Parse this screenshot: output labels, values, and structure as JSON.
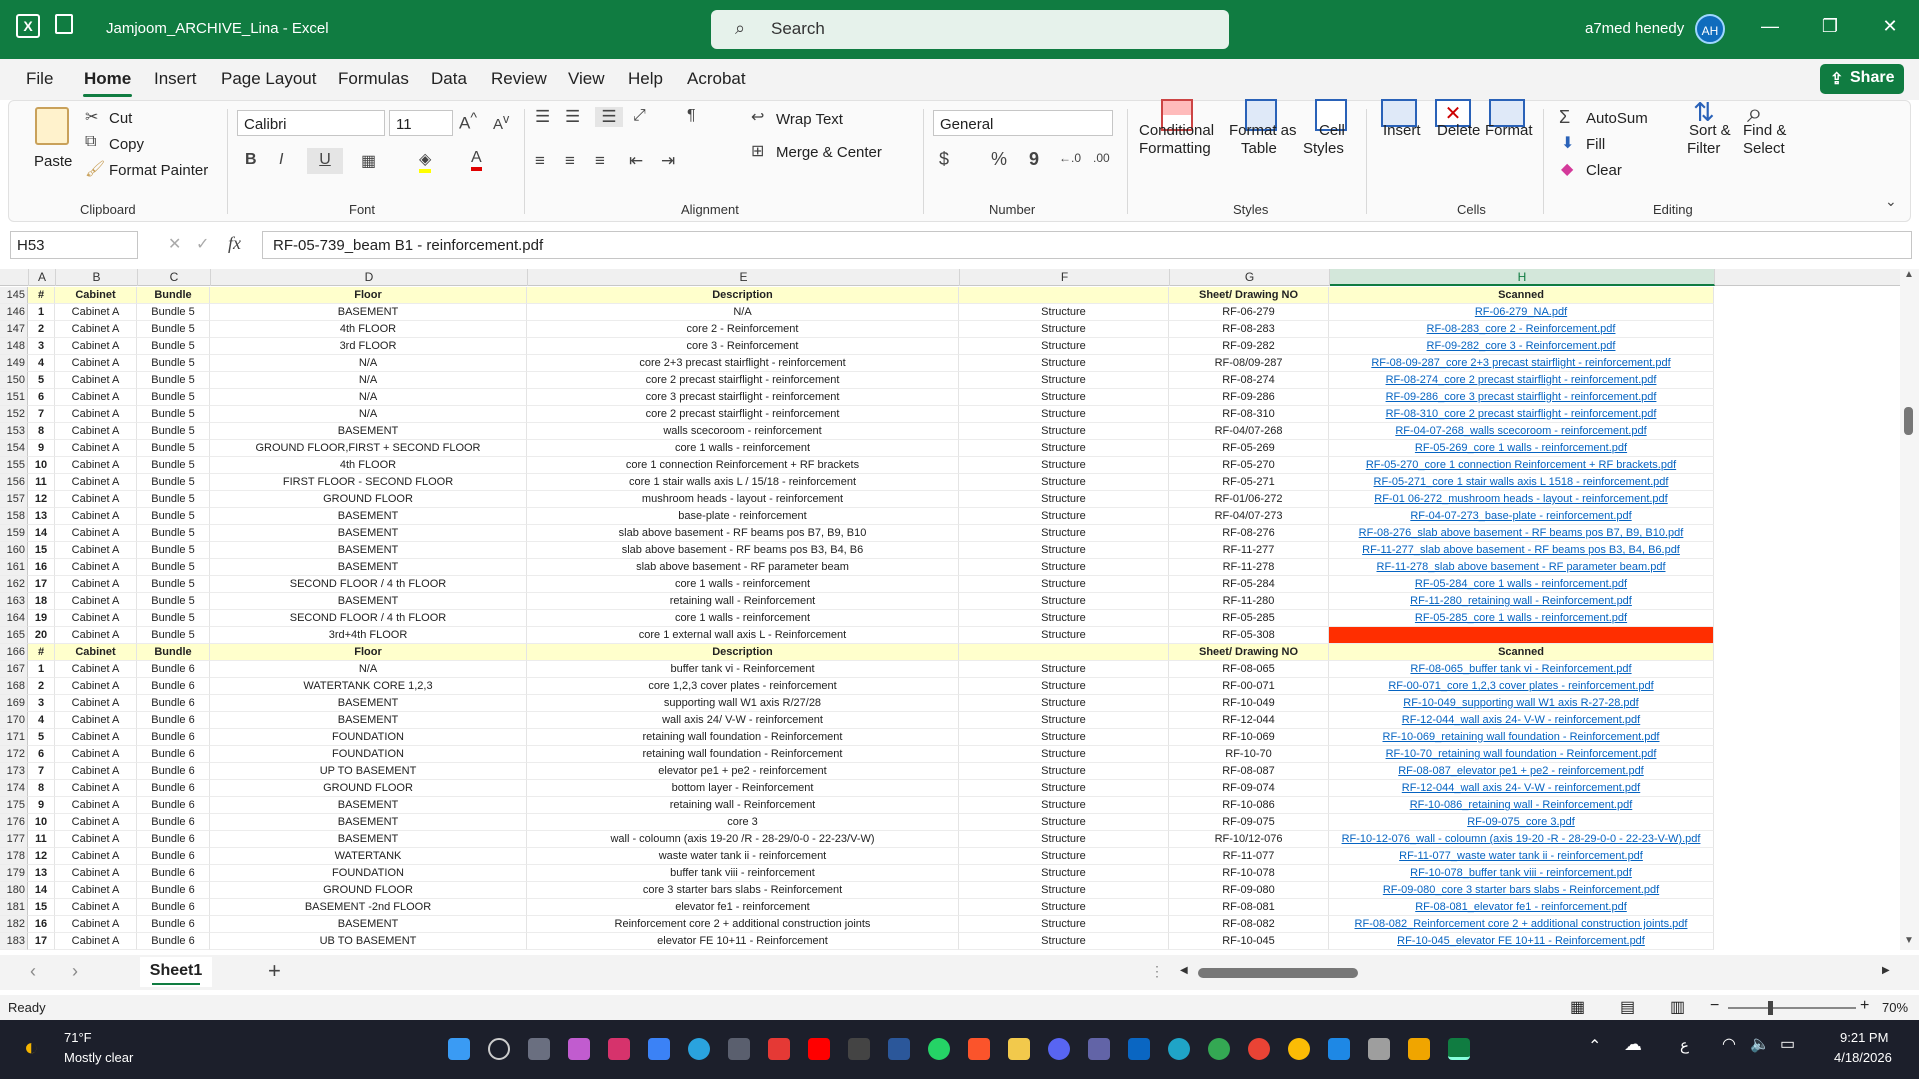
{
  "app": {
    "title": "Jamjoom_ARCHIVE_Lina  -  Excel",
    "search": "Search",
    "user": "a7med henedy",
    "initials": "AH"
  },
  "menu": [
    "File",
    "Home",
    "Insert",
    "Page Layout",
    "Formulas",
    "Data",
    "Review",
    "View",
    "Help",
    "Acrobat"
  ],
  "share": "Share",
  "ribbon": {
    "clipboard": {
      "paste": "Paste",
      "cut": "Cut",
      "copy": "Copy",
      "painter": "Format Painter",
      "label": "Clipboard"
    },
    "font": {
      "name": "Calibri",
      "size": "11",
      "label": "Font"
    },
    "alignment": {
      "wrap": "Wrap Text",
      "merge": "Merge & Center",
      "label": "Alignment"
    },
    "number": {
      "format": "General",
      "label": "Number"
    },
    "styles": {
      "cond": "Conditional",
      "cond2": "Formatting",
      "fmt": "Format as",
      "fmt2": "Table",
      "cell": "Cell",
      "cell2": "Styles",
      "label": "Styles"
    },
    "cells": {
      "insert": "Insert",
      "delete": "Delete",
      "format": "Format",
      "label": "Cells"
    },
    "editing": {
      "autosum": "AutoSum",
      "fill": "Fill",
      "clear": "Clear",
      "sort": "Sort &",
      "sort2": "Filter",
      "find": "Find &",
      "find2": "Select",
      "label": "Editing"
    }
  },
  "formula": {
    "cell": "H53",
    "value": "RF-05-739_beam B1 - reinforcement.pdf"
  },
  "columns": [
    "A",
    "B",
    "C",
    "D",
    "E",
    "F",
    "G",
    "H"
  ],
  "header_labels": [
    "#",
    "Cabinet",
    "Bundle",
    "Floor",
    "Description",
    "",
    "Sheet/ Drawing NO",
    "Scanned"
  ],
  "rows": [
    [
      "145",
      "#",
      "Cabinet",
      "Bundle",
      "Floor",
      "Description",
      "",
      "Sheet/ Drawing NO",
      "Scanned",
      "hdr"
    ],
    [
      "146",
      "1",
      "Cabinet A",
      "Bundle 5",
      "BASEMENT",
      "N/A",
      "Structure",
      "RF-06-279",
      "RF-06-279_NA.pdf"
    ],
    [
      "147",
      "2",
      "Cabinet A",
      "Bundle 5",
      "4th FLOOR",
      "core 2 - Reinforcement",
      "Structure",
      "RF-08-283",
      "RF-08-283_core 2 - Reinforcement.pdf"
    ],
    [
      "148",
      "3",
      "Cabinet A",
      "Bundle 5",
      "3rd FLOOR",
      "core 3 - Reinforcement",
      "Structure",
      "RF-09-282",
      "RF-09-282_core 3 - Reinforcement.pdf"
    ],
    [
      "149",
      "4",
      "Cabinet A",
      "Bundle 5",
      "N/A",
      "core 2+3 precast stairflight - reinforcement",
      "Structure",
      "RF-08/09-287",
      "RF-08-09-287_core 2+3 precast stairflight - reinforcement.pdf"
    ],
    [
      "150",
      "5",
      "Cabinet A",
      "Bundle 5",
      "N/A",
      "core 2 precast stairflight - reinforcement",
      "Structure",
      "RF-08-274",
      "RF-08-274_core 2 precast stairflight - reinforcement.pdf"
    ],
    [
      "151",
      "6",
      "Cabinet A",
      "Bundle 5",
      "N/A",
      "core 3 precast stairflight - reinforcement",
      "Structure",
      "RF-09-286",
      "RF-09-286_core 3 precast stairflight - reinforcement.pdf"
    ],
    [
      "152",
      "7",
      "Cabinet A",
      "Bundle 5",
      "N/A",
      "core 2 precast stairflight - reinforcement",
      "Structure",
      "RF-08-310",
      "RF-08-310_core 2 precast stairflight - reinforcement.pdf"
    ],
    [
      "153",
      "8",
      "Cabinet A",
      "Bundle 5",
      "BASEMENT",
      "walls scecoroom - reinforcement",
      "Structure",
      "RF-04/07-268",
      "RF-04-07-268_walls scecoroom - reinforcement.pdf"
    ],
    [
      "154",
      "9",
      "Cabinet A",
      "Bundle 5",
      "GROUND FLOOR,FIRST + SECOND FLOOR",
      "core 1 walls - reinforcement",
      "Structure",
      "RF-05-269",
      "RF-05-269_core 1 walls - reinforcement.pdf"
    ],
    [
      "155",
      "10",
      "Cabinet A",
      "Bundle 5",
      "4th FLOOR",
      "core 1 connection Reinforcement + RF brackets",
      "Structure",
      "RF-05-270",
      "RF-05-270_core 1 connection Reinforcement + RF brackets.pdf"
    ],
    [
      "156",
      "11",
      "Cabinet A",
      "Bundle 5",
      "FIRST FLOOR - SECOND FLOOR",
      "core 1 stair walls axis L / 15/18 - reinforcement",
      "Structure",
      "RF-05-271",
      "RF-05-271_core 1 stair walls axis L 1518 - reinforcement.pdf"
    ],
    [
      "157",
      "12",
      "Cabinet A",
      "Bundle 5",
      "GROUND FLOOR",
      "mushroom heads - layout - reinforcement",
      "Structure",
      "RF-01/06-272",
      "RF-01 06-272_mushroom heads - layout - reinforcement.pdf"
    ],
    [
      "158",
      "13",
      "Cabinet A",
      "Bundle 5",
      "BASEMENT",
      "base-plate - reinforcement",
      "Structure",
      "RF-04/07-273",
      "RF-04-07-273_base-plate - reinforcement.pdf"
    ],
    [
      "159",
      "14",
      "Cabinet A",
      "Bundle 5",
      "BASEMENT",
      "slab above basement - RF beams pos B7, B9, B10",
      "Structure",
      "RF-08-276",
      "RF-08-276_slab above basement - RF beams pos B7, B9, B10.pdf"
    ],
    [
      "160",
      "15",
      "Cabinet A",
      "Bundle 5",
      "BASEMENT",
      "slab above basement - RF beams pos B3, B4, B6",
      "Structure",
      "RF-11-277",
      "RF-11-277_slab above basement - RF beams pos B3, B4, B6.pdf"
    ],
    [
      "161",
      "16",
      "Cabinet A",
      "Bundle 5",
      "BASEMENT",
      "slab above basement - RF parameter beam",
      "Structure",
      "RF-11-278",
      "RF-11-278_slab above basement - RF parameter beam.pdf"
    ],
    [
      "162",
      "17",
      "Cabinet A",
      "Bundle 5",
      "SECOND FLOOR / 4 th FLOOR",
      "core 1 walls - reinforcement",
      "Structure",
      "RF-05-284",
      "RF-05-284_core 1 walls - reinforcement.pdf"
    ],
    [
      "163",
      "18",
      "Cabinet A",
      "Bundle 5",
      "BASEMENT",
      "retaining wall - Reinforcement",
      "Structure",
      "RF-11-280",
      "RF-11-280_retaining wall - Reinforcement.pdf"
    ],
    [
      "164",
      "19",
      "Cabinet A",
      "Bundle 5",
      "SECOND FLOOR / 4 th FLOOR",
      "core 1 walls - reinforcement",
      "Structure",
      "RF-05-285",
      "RF-05-285_core 1 walls - reinforcement.pdf"
    ],
    [
      "165",
      "20",
      "Cabinet A",
      "Bundle 5",
      "3rd+4th FLOOR",
      "core 1 external wall axis L - Reinforcement",
      "Structure",
      "RF-05-308",
      "",
      "red"
    ],
    [
      "166",
      "#",
      "Cabinet",
      "Bundle",
      "Floor",
      "Description",
      "",
      "Sheet/ Drawing NO",
      "Scanned",
      "hdr"
    ],
    [
      "167",
      "1",
      "Cabinet A",
      "Bundle 6",
      "N/A",
      "buffer tank vi - Reinforcement",
      "Structure",
      "RF-08-065",
      "RF-08-065_buffer tank vi - Reinforcement.pdf"
    ],
    [
      "168",
      "2",
      "Cabinet A",
      "Bundle 6",
      "WATERTANK CORE 1,2,3",
      "core 1,2,3 cover plates - reinforcement",
      "Structure",
      "RF-00-071",
      "RF-00-071_core 1,2,3 cover plates - reinforcement.pdf"
    ],
    [
      "169",
      "3",
      "Cabinet A",
      "Bundle 6",
      "BASEMENT",
      "supporting wall W1 axis R/27/28",
      "Structure",
      "RF-10-049",
      "RF-10-049_supporting wall W1 axis R-27-28.pdf"
    ],
    [
      "170",
      "4",
      "Cabinet A",
      "Bundle 6",
      "BASEMENT",
      "wall axis 24/ V-W - reinforcement",
      "Structure",
      "RF-12-044",
      "RF-12-044_wall axis 24- V-W - reinforcement.pdf"
    ],
    [
      "171",
      "5",
      "Cabinet A",
      "Bundle 6",
      "FOUNDATION",
      "retaining wall foundation  - Reinforcement",
      "Structure",
      "RF-10-069",
      "RF-10-069_retaining wall foundation - Reinforcement.pdf"
    ],
    [
      "172",
      "6",
      "Cabinet A",
      "Bundle 6",
      "FOUNDATION",
      "retaining wall foundation  - Reinforcement",
      "Structure",
      "RF-10-70",
      "RF-10-70_retaining wall foundation - Reinforcement.pdf"
    ],
    [
      "173",
      "7",
      "Cabinet A",
      "Bundle 6",
      "UP TO BASEMENT",
      "elevator pe1 + pe2 - reinforcement",
      "Structure",
      "RF-08-087",
      "RF-08-087_elevator pe1 + pe2 - reinforcement.pdf"
    ],
    [
      "174",
      "8",
      "Cabinet A",
      "Bundle 6",
      "GROUND FLOOR",
      "bottom layer - Reinforcement",
      "Structure",
      "RF-09-074",
      "RF-12-044_wall axis 24- V-W - reinforcement.pdf"
    ],
    [
      "175",
      "9",
      "Cabinet A",
      "Bundle 6",
      "BASEMENT",
      "retaining wall - Reinforcement",
      "Structure",
      "RF-10-086",
      "RF-10-086_retaining wall - Reinforcement.pdf"
    ],
    [
      "176",
      "10",
      "Cabinet A",
      "Bundle 6",
      "BASEMENT",
      "core 3",
      "Structure",
      "RF-09-075",
      "RF-09-075_core 3.pdf"
    ],
    [
      "177",
      "11",
      "Cabinet A",
      "Bundle 6",
      "BASEMENT",
      "wall - coloumn (axis 19-20 /R - 28-29/0-0 - 22-23/V-W)",
      "Structure",
      "RF-10/12-076",
      "RF-10-12-076_wall - coloumn (axis 19-20 -R - 28-29-0-0 - 22-23-V-W).pdf"
    ],
    [
      "178",
      "12",
      "Cabinet A",
      "Bundle 6",
      "WATERTANK",
      "waste water tank ii - reinforcement",
      "Structure",
      "RF-11-077",
      "RF-11-077_waste water tank ii - reinforcement.pdf"
    ],
    [
      "179",
      "13",
      "Cabinet A",
      "Bundle 6",
      "FOUNDATION",
      "buffer tank viii - reinforcement",
      "Structure",
      "RF-10-078",
      "RF-10-078_buffer tank viii - reinforcement.pdf"
    ],
    [
      "180",
      "14",
      "Cabinet A",
      "Bundle 6",
      "GROUND FLOOR",
      "core 3 starter bars slabs - Reinforcement",
      "Structure",
      "RF-09-080",
      "RF-09-080_core 3 starter bars slabs - Reinforcement.pdf"
    ],
    [
      "181",
      "15",
      "Cabinet A",
      "Bundle 6",
      "BASEMENT -2nd FLOOR",
      "elevator fe1 - reinforcement",
      "Structure",
      "RF-08-081",
      "RF-08-081_elevator fe1 - reinforcement.pdf"
    ],
    [
      "182",
      "16",
      "Cabinet A",
      "Bundle 6",
      "BASEMENT",
      "Reinforcement core 2 + additional construction joints",
      "Structure",
      "RF-08-082",
      "RF-08-082_Reinforcement core 2 + additional construction joints.pdf"
    ],
    [
      "183",
      "17",
      "Cabinet A",
      "Bundle 6",
      "UB TO BASEMENT",
      "elevator FE 10+11 - Reinforcement",
      "Structure",
      "RF-10-045",
      "RF-10-045_elevator FE 10+11 - Reinforcement.pdf"
    ]
  ],
  "sheet_tab": "Sheet1",
  "status": {
    "ready": "Ready",
    "zoom": "70%"
  },
  "taskbar": {
    "temp": "71°F",
    "weather": "Mostly clear",
    "time": "9:21 PM",
    "date": "4/18/2026"
  }
}
